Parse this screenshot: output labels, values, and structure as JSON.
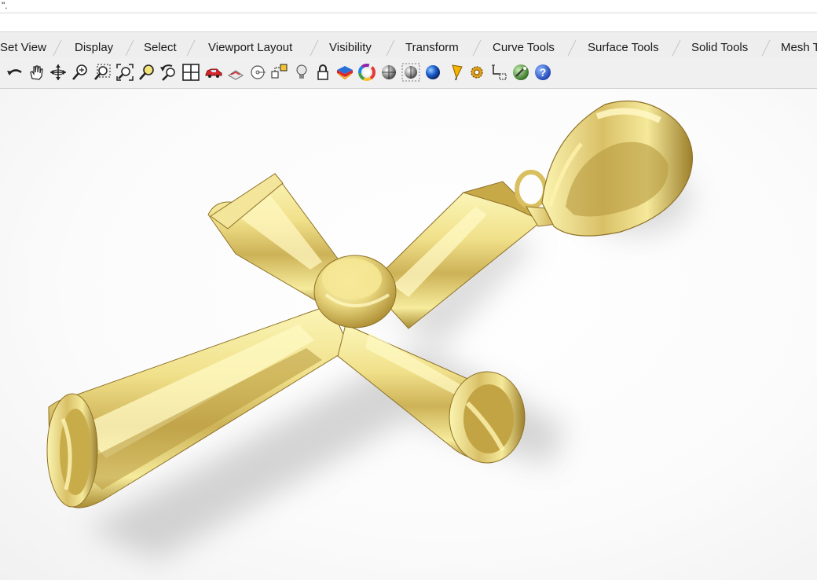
{
  "command_line": {
    "text": "\"."
  },
  "tabs": [
    {
      "label": "Set View"
    },
    {
      "label": "Display"
    },
    {
      "label": "Select"
    },
    {
      "label": "Viewport Layout"
    },
    {
      "label": "Visibility"
    },
    {
      "label": "Transform"
    },
    {
      "label": "Curve Tools"
    },
    {
      "label": "Surface Tools"
    },
    {
      "label": "Solid Tools"
    },
    {
      "label": "Mesh T"
    }
  ],
  "toolbar": {
    "icons": [
      "undo-view-icon",
      "pan-hand-icon",
      "rotate-view-icon",
      "zoom-icon",
      "zoom-window-icon",
      "zoom-extents-icon",
      "zoom-selected-icon",
      "undo-zoom-icon",
      "four-viewports-icon",
      "car-icon",
      "named-view-icon",
      "target-icon",
      "layout-icon",
      "light-bulb-icon",
      "lock-icon",
      "layer-icon",
      "color-wheel-icon",
      "shaded-sphere-icon",
      "rendered-sphere-icon",
      "blue-sphere-icon",
      "pencil-icon",
      "gear-icon",
      "dimension-icon",
      "globe-icon",
      "help-icon"
    ]
  },
  "viewport": {
    "object": "gold cross pendant",
    "colors": {
      "gold_light": "#f7ef9e",
      "gold_mid": "#e3cf72",
      "gold_dark": "#9c7f2c",
      "background": "#ffffff"
    }
  }
}
